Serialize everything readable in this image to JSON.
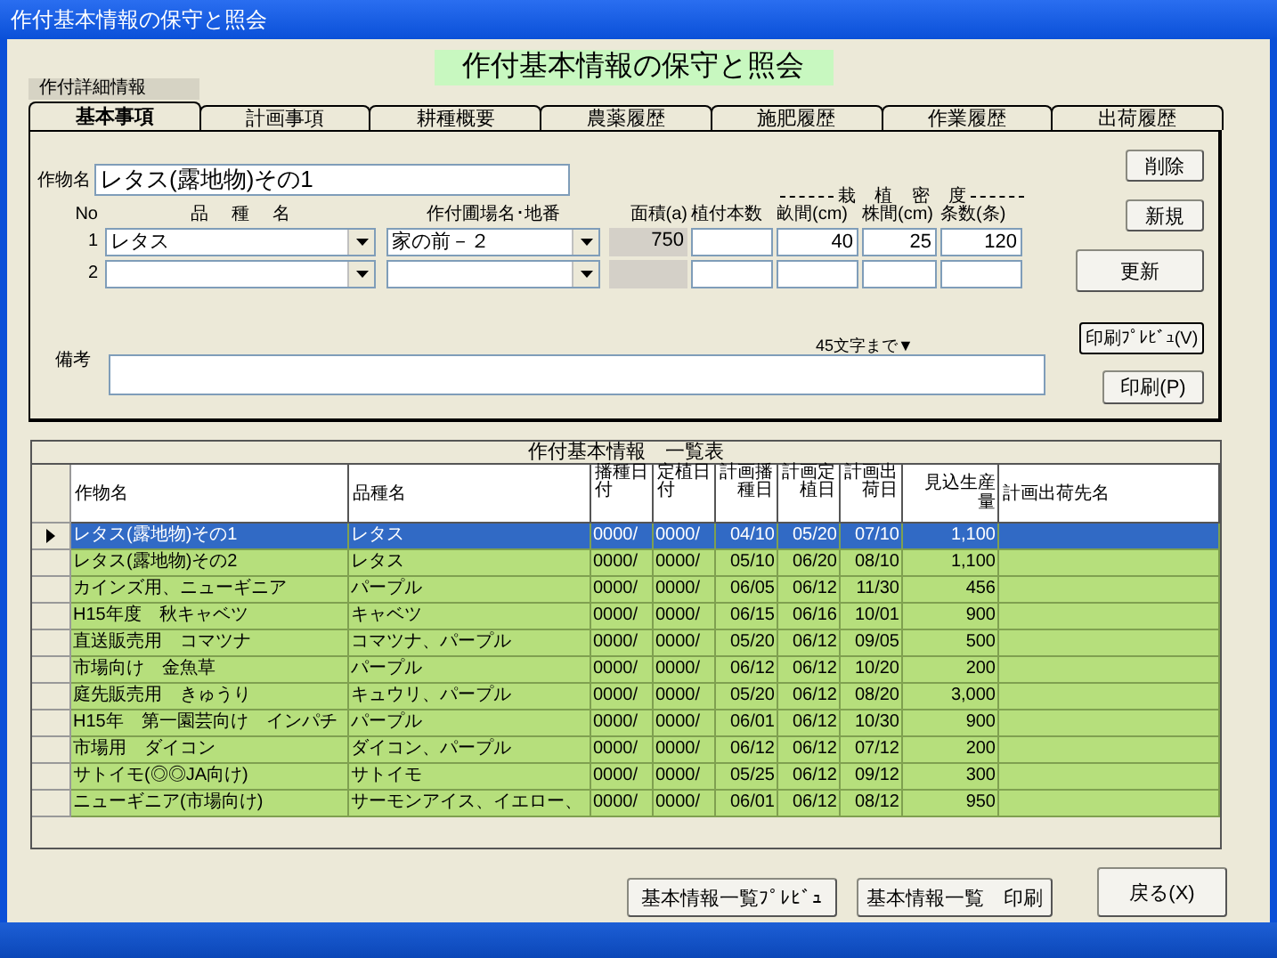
{
  "window": {
    "title": "作付基本情報の保守と照会"
  },
  "heading": "作付基本情報の保守と照会",
  "section_label": "作付詳細情報",
  "tabs": [
    {
      "label": "基本事項",
      "selected": true
    },
    {
      "label": "計画事項",
      "selected": false
    },
    {
      "label": "耕種概要",
      "selected": false
    },
    {
      "label": "農薬履歴",
      "selected": false
    },
    {
      "label": "施肥履歴",
      "selected": false
    },
    {
      "label": "作業履歴",
      "selected": false
    },
    {
      "label": "出荷履歴",
      "selected": false
    }
  ],
  "crop_name": {
    "label": "作物名",
    "value": "レタス(露地物)その1"
  },
  "planting": {
    "headers": {
      "no": "No",
      "variety": "品 種 名",
      "field": "作付圃場名･地番",
      "area": "面積(a)",
      "plant_count": "植付本数",
      "density": "栽 植 密 度",
      "ridge": "畝間(cm)",
      "stock": "株間(cm)",
      "strips": "条数(条)"
    },
    "rows": [
      {
        "no": "1",
        "variety": "レタス",
        "field": "家の前－２",
        "area": "750",
        "plant_count": "",
        "ridge": "40",
        "stock": "25",
        "strips": "120"
      },
      {
        "no": "2",
        "variety": "",
        "field": "",
        "area": "",
        "plant_count": "",
        "ridge": "",
        "stock": "",
        "strips": ""
      }
    ]
  },
  "remarks": {
    "label": "備考",
    "hint": "45文字まで▼"
  },
  "side_buttons": {
    "delete": "削除",
    "new": "新規",
    "update": "更新",
    "preview": "印刷ﾌﾟﾚﾋﾞｭ(V)",
    "print": "印刷(P)"
  },
  "grid": {
    "caption": "作付基本情報　一覧表",
    "columns": [
      "作物名",
      "品種名",
      "播種日付",
      "定植日付",
      "計画播種日",
      "計画定植日",
      "計画出荷日",
      "見込生産量",
      "計画出荷先名"
    ],
    "rows": [
      {
        "selected": true,
        "cells": [
          "レタス(露地物)その1",
          "レタス",
          "0000/",
          "0000/",
          "04/10",
          "05/20",
          "07/10",
          "1,100",
          ""
        ]
      },
      {
        "selected": false,
        "cells": [
          "レタス(露地物)その2",
          "レタス",
          "0000/",
          "0000/",
          "05/10",
          "06/20",
          "08/10",
          "1,100",
          ""
        ]
      },
      {
        "selected": false,
        "cells": [
          "カインズ用、ニューギニア",
          "パープル",
          "0000/",
          "0000/",
          "06/05",
          "06/12",
          "11/30",
          "456",
          ""
        ]
      },
      {
        "selected": false,
        "cells": [
          "H15年度　秋キャベツ",
          "キャベツ",
          "0000/",
          "0000/",
          "06/15",
          "06/16",
          "10/01",
          "900",
          ""
        ]
      },
      {
        "selected": false,
        "cells": [
          "直送販売用　コマツナ",
          "コマツナ、パープル",
          "0000/",
          "0000/",
          "05/20",
          "06/12",
          "09/05",
          "500",
          ""
        ]
      },
      {
        "selected": false,
        "cells": [
          "市場向け　金魚草",
          "パープル",
          "0000/",
          "0000/",
          "06/12",
          "06/12",
          "10/20",
          "200",
          ""
        ]
      },
      {
        "selected": false,
        "cells": [
          "庭先販売用　きゅうり",
          "キュウリ、パープル",
          "0000/",
          "0000/",
          "05/20",
          "06/12",
          "08/20",
          "3,000",
          ""
        ]
      },
      {
        "selected": false,
        "cells": [
          "H15年　第一園芸向け　インパチ",
          "パープル",
          "0000/",
          "0000/",
          "06/01",
          "06/12",
          "10/30",
          "900",
          ""
        ]
      },
      {
        "selected": false,
        "cells": [
          "市場用　ダイコン",
          "ダイコン、パープル",
          "0000/",
          "0000/",
          "06/12",
          "06/12",
          "07/12",
          "200",
          ""
        ]
      },
      {
        "selected": false,
        "cells": [
          "サトイモ(◎◎JA向け)",
          "サトイモ",
          "0000/",
          "0000/",
          "05/25",
          "06/12",
          "09/12",
          "300",
          ""
        ]
      },
      {
        "selected": false,
        "cells": [
          "ニューギニア(市場向け)",
          "サーモンアイス、イエロー、",
          "0000/",
          "0000/",
          "06/01",
          "06/12",
          "08/12",
          "950",
          ""
        ]
      }
    ]
  },
  "bottom_buttons": [
    "基本情報一覧ﾌﾟﾚﾋﾞｭ",
    "基本情報一覧　印刷",
    "戻る(X)"
  ]
}
